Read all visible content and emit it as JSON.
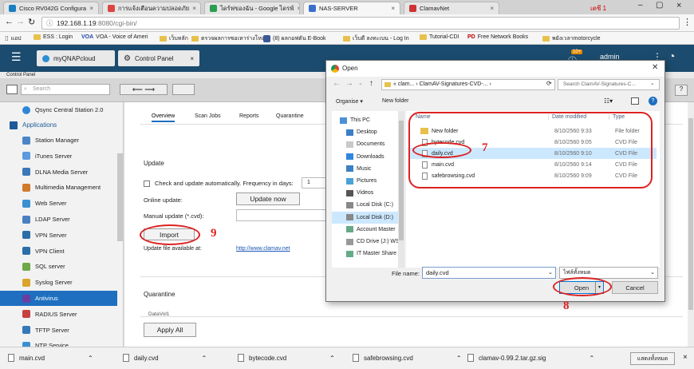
{
  "browser": {
    "tabs": [
      {
        "label": "Cisco RV042G Configura",
        "icon_color": "#1a7fc1"
      },
      {
        "label": "การแจ้งเตือนความปลอดภัย",
        "icon_color": "#d44"
      },
      {
        "label": "ไดร์ฟของฉัน - Google ไดรฟ์",
        "icon_color": "#2a9d50"
      },
      {
        "label": "NAS-SERVER",
        "icon_color": "#3a6fd0"
      },
      {
        "label": "ClamavNet",
        "icon_color": "#c33"
      }
    ],
    "profile": "เดชี 1",
    "url_host": "192.168.1.19",
    "url_path": ":8080/cgi-bin/",
    "bookmarks": [
      "แอป",
      "ESS : Login",
      "VOA - Voice of Ameri",
      "เว็บหลัก",
      "ตรวจผลการซอเหาร่างโหล",
      "(8) ผลกอฟตัน E-Book",
      "เว็บดี ลงทะเบน - Log In",
      "Tutorial-CDI",
      "Free Network Books",
      "พยังเวลาmotorcycle"
    ]
  },
  "qnap": {
    "tab_cloud": "myQNAPcloud",
    "tab_cp": "Control Panel",
    "user": "admin",
    "notif_count": "10+",
    "cp_label": "Control Panel",
    "search_placeholder": "Search"
  },
  "sidebar": {
    "top_item": "Qsync Central Station 2.0",
    "section": "Applications",
    "items": [
      {
        "label": "Station Manager",
        "color": "#4a86c5"
      },
      {
        "label": "iTunes Server",
        "color": "#5a9adf"
      },
      {
        "label": "DLNA Media Server",
        "color": "#3b77b8"
      },
      {
        "label": "Multimedia Management",
        "color": "#d27a2b"
      },
      {
        "label": "Web Server",
        "color": "#3a8fd3"
      },
      {
        "label": "LDAP Server",
        "color": "#4b7fbf"
      },
      {
        "label": "VPN Server",
        "color": "#2c6ea8"
      },
      {
        "label": "VPN Client",
        "color": "#2c6ea8"
      },
      {
        "label": "SQL server",
        "color": "#6da84a"
      },
      {
        "label": "Syslog Server",
        "color": "#d9a42b"
      },
      {
        "label": "Antivirus",
        "color": "#6a3fa0"
      },
      {
        "label": "RADIUS Server",
        "color": "#c64040"
      },
      {
        "label": "TFTP Server",
        "color": "#3578b8"
      },
      {
        "label": "NTP Service",
        "color": "#3a8fd3"
      }
    ]
  },
  "content": {
    "tabs": [
      "Overview",
      "Scan Jobs",
      "Reports",
      "Quarantine"
    ],
    "update_heading": "Update",
    "auto_update_label": "Check and update automatically. Frequency in days:",
    "frequency_value": "1",
    "online_update_label": "Online update:",
    "update_now": "Update now",
    "manual_update_label": "Manual update (*.cvd):",
    "import": "Import",
    "file_available_label": "Update file available at:",
    "clamav_link": "http://www.clamav.net",
    "quarantine_heading": "Quarantine",
    "datavol": "DataVol1",
    "apply_all": "Apply All"
  },
  "dialog": {
    "title": "Open",
    "breadcrumb": "«  clam...  ›  ClamAV-Signatures-CVD-...  ›",
    "search_placeholder": "Search ClamAV-Signatures-C...",
    "organise": "Organise ▾",
    "new_folder": "New folder",
    "nav": [
      {
        "label": "This PC",
        "icon": "pc-icon",
        "color": "#4a90d9"
      },
      {
        "label": "Desktop",
        "icon": "desktop-icon",
        "color": "#3b7fc4"
      },
      {
        "label": "Documents",
        "icon": "documents-icon",
        "color": "#c9c9c9"
      },
      {
        "label": "Downloads",
        "icon": "downloads-icon",
        "color": "#2e86de"
      },
      {
        "label": "Music",
        "icon": "music-icon",
        "color": "#3b7fc4"
      },
      {
        "label": "Pictures",
        "icon": "pictures-icon",
        "color": "#4aa0d8"
      },
      {
        "label": "Videos",
        "icon": "videos-icon",
        "color": "#555"
      },
      {
        "label": "Local Disk (C:)",
        "icon": "disk-icon",
        "color": "#888"
      },
      {
        "label": "Local Disk (D:)",
        "icon": "disk-icon",
        "color": "#888"
      },
      {
        "label": "Account Master",
        "icon": "network-drive-icon",
        "color": "#6a8"
      },
      {
        "label": "CD Drive (J:) WS",
        "icon": "cd-icon",
        "color": "#999"
      },
      {
        "label": "IT Master Share (",
        "icon": "network-drive-icon",
        "color": "#6a8"
      }
    ],
    "columns": [
      "Name",
      "Date modified",
      "Type"
    ],
    "files": [
      {
        "name": "New folder",
        "date": "8/10/2560 9:33",
        "type": "File folder",
        "folder": true
      },
      {
        "name": "bytecode.cvd",
        "date": "8/10/2560 9:05",
        "type": "CVD File"
      },
      {
        "name": "daily.cvd",
        "date": "8/10/2560 9:10",
        "type": "CVD File"
      },
      {
        "name": "main.cvd",
        "date": "8/10/2560 9:14",
        "type": "CVD File"
      },
      {
        "name": "safebrowsing.cvd",
        "date": "8/10/2560 9:09",
        "type": "CVD File"
      }
    ],
    "file_name_label": "File name:",
    "file_name_value": "daily.cvd",
    "file_type": "ไฟล์ทั้งหมด",
    "open": "Open",
    "cancel": "Cancel"
  },
  "annotations": {
    "step7": "7",
    "step8": "8",
    "step9": "9"
  },
  "downloads": {
    "items": [
      "main.cvd",
      "daily.cvd",
      "bytecode.cvd",
      "safebrowsing.cvd",
      "clamav-0.99.2.tar.gz.sig"
    ],
    "show_all": "แสดงทั้งหมด"
  }
}
